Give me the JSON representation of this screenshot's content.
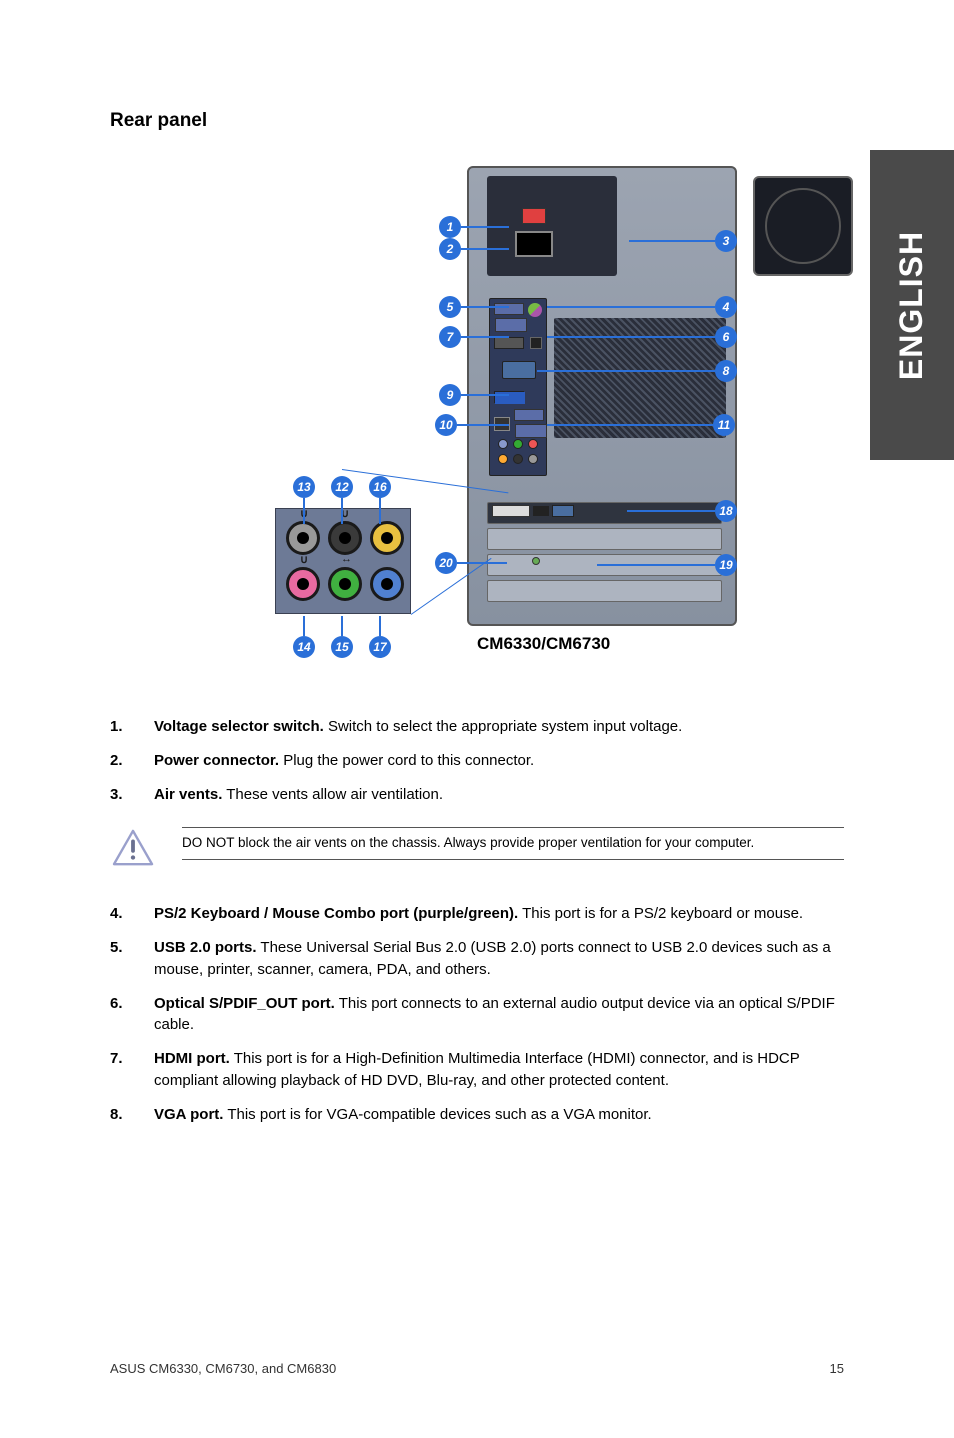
{
  "language_tab": "ENGLISH",
  "section_title": "Rear panel",
  "diagram": {
    "model_label": "CM6330/CM6730",
    "callouts": [
      "1",
      "2",
      "3",
      "4",
      "5",
      "6",
      "7",
      "8",
      "9",
      "10",
      "11",
      "12",
      "13",
      "14",
      "15",
      "16",
      "17",
      "18",
      "19",
      "20"
    ]
  },
  "definitions": [
    {
      "num": "1.",
      "term": "Voltage selector switch.",
      "desc": " Switch to select the appropriate system input voltage."
    },
    {
      "num": "2.",
      "term": "Power connector.",
      "desc": " Plug the power cord to this connector."
    },
    {
      "num": "3.",
      "term": "Air vents.",
      "desc": " These vents allow air ventilation."
    }
  ],
  "note": "DO NOT block the air vents on the chassis. Always provide proper ventilation for your computer.",
  "definitions2": [
    {
      "num": "4.",
      "term": "PS/2 Keyboard / Mouse Combo port (purple/green).",
      "desc": " This port is for a PS/2 keyboard or mouse."
    },
    {
      "num": "5.",
      "term": "USB 2.0 ports.",
      "desc": " These Universal Serial Bus 2.0 (USB 2.0) ports connect to USB 2.0 devices such as a mouse, printer, scanner, camera, PDA, and others."
    },
    {
      "num": "6.",
      "term": "Optical S/PDIF_OUT port.",
      "desc": " This port connects to an external audio output device via an optical S/PDIF cable."
    },
    {
      "num": "7.",
      "term": "HDMI port.",
      "desc": " This port is for a High-Definition Multimedia Interface (HDMI) connector, and is HDCP compliant allowing playback of HD DVD, Blu-ray, and other protected content."
    },
    {
      "num": "8.",
      "term": "VGA port.",
      "desc": " This port is for VGA-compatible devices such as a VGA monitor."
    }
  ],
  "footer": {
    "left": "ASUS CM6330, CM6730, and CM6830",
    "right": "15"
  }
}
